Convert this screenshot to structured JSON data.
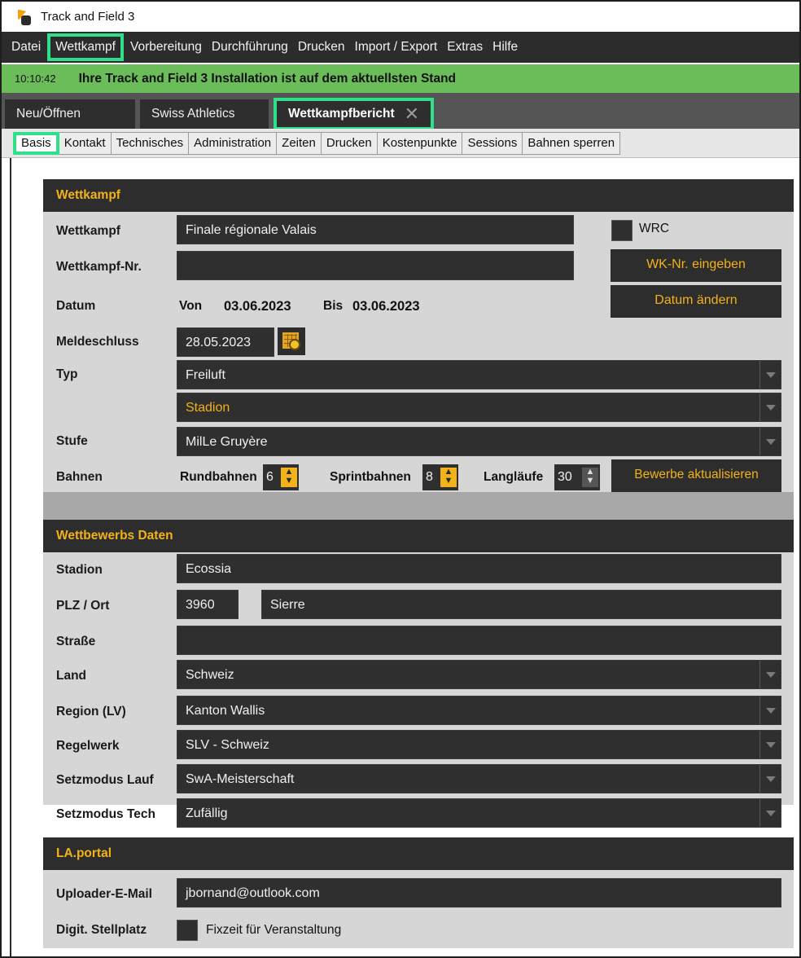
{
  "window": {
    "title": "Track and Field 3"
  },
  "menu": [
    "Datei",
    "Wettkampf",
    "Vorbereitung",
    "Durchführung",
    "Drucken",
    "Import / Export",
    "Extras",
    "Hilfe"
  ],
  "status": {
    "time": "10:10:42",
    "message": "Ihre Track and Field 3 Installation ist auf dem aktuellsten Stand"
  },
  "tabs": [
    "Neu/Öffnen",
    "Swiss Athletics",
    "Wettkampfbericht"
  ],
  "close_glyph": "✕",
  "subtabs": [
    "Basis",
    "Kontakt",
    "Technisches",
    "Administration",
    "Zeiten",
    "Drucken",
    "Kostenpunkte",
    "Sessions",
    "Bahnen sperren"
  ],
  "wettkampf": {
    "header": "Wettkampf",
    "labels": {
      "wettkampf": "Wettkampf",
      "nr": "Wettkampf-Nr.",
      "datum": "Datum",
      "meldeschluss": "Meldeschluss",
      "typ": "Typ",
      "stufe": "Stufe",
      "bahnen": "Bahnen"
    },
    "name": "Finale régionale Valais",
    "nr": "",
    "wrc_label": "WRC",
    "wk_nr_button": "WK-Nr. eingeben",
    "datum_button": "Datum ändern",
    "von_label": "Von",
    "von": "03.06.2023",
    "bis_label": "Bis",
    "bis": "03.06.2023",
    "meldeschluss": "28.05.2023",
    "typ": "Freiluft",
    "typ2": "Stadion",
    "stufe": "MilLe Gruyère",
    "rundbahnen_label": "Rundbahnen",
    "rundbahnen": "6",
    "sprintbahnen_label": "Sprintbahnen",
    "sprintbahnen": "8",
    "langlaeufe_label": "Langläufe",
    "langlaeufe": "30",
    "update_button": "Bewerbe aktualisieren"
  },
  "daten": {
    "header": "Wettbewerbs Daten",
    "labels": {
      "stadion": "Stadion",
      "plz": "PLZ / Ort",
      "strasse": "Straße",
      "land": "Land",
      "region": "Region (LV)",
      "regelwerk": "Regelwerk",
      "setz_lauf": "Setzmodus Lauf",
      "setz_tech": "Setzmodus Tech"
    },
    "stadion": "Ecossia",
    "plz": "3960",
    "ort": "Sierre",
    "strasse": "",
    "land": "Schweiz",
    "region": "Kanton Wallis",
    "regelwerk": "SLV - Schweiz",
    "setz_lauf": "SwA-Meisterschaft",
    "setz_tech": "Zufällig"
  },
  "portal": {
    "header": "LA.portal",
    "labels": {
      "email": "Uploader-E-Mail",
      "stellplatz": "Digit. Stellplatz"
    },
    "email": "jbornand@outlook.com",
    "fixzeit": "Fixzeit für Veranstaltung"
  }
}
